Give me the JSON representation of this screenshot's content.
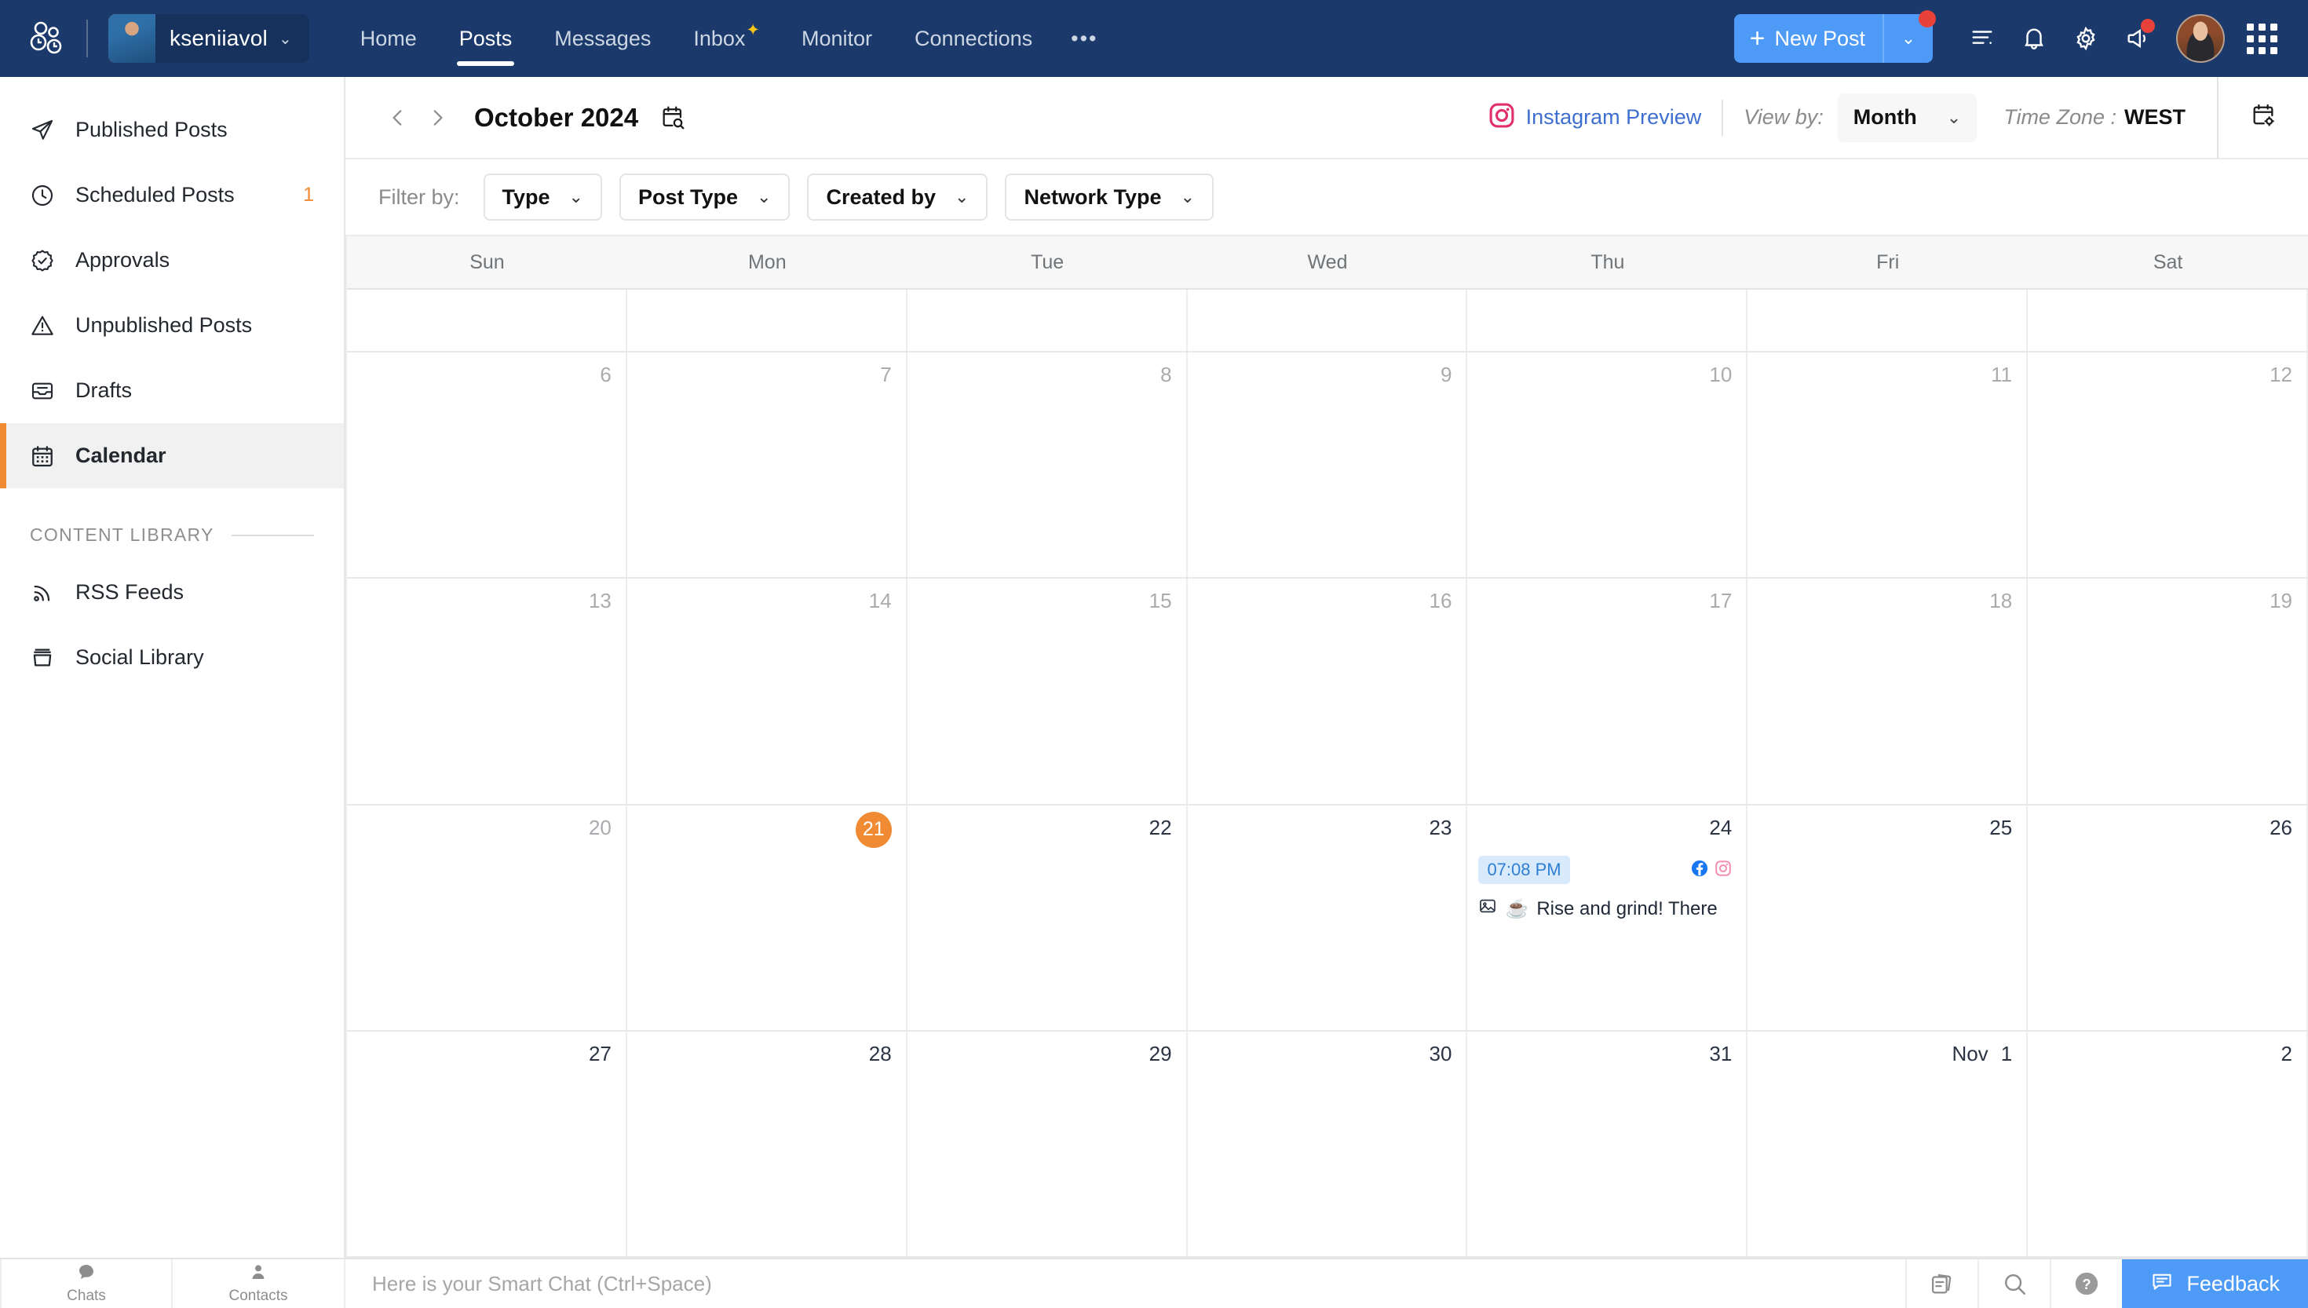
{
  "topnav": {
    "logo_icon": "zoho-social-logo-icon",
    "account": {
      "name": "kseniiavol",
      "avatar": "user-avatar",
      "caret": "⌄"
    },
    "tabs": [
      {
        "label": "Home",
        "active": false
      },
      {
        "label": "Posts",
        "active": true
      },
      {
        "label": "Messages",
        "active": false
      },
      {
        "label": "Inbox",
        "active": false,
        "sparkle": "✦"
      },
      {
        "label": "Monitor",
        "active": false
      },
      {
        "label": "Connections",
        "active": false
      }
    ],
    "more_label": "•••",
    "new_post": {
      "label": "New Post",
      "plus": "+",
      "caret": "⌄",
      "has_badge": true
    },
    "icons": [
      {
        "name": "activity-list-icon",
        "badge": false
      },
      {
        "name": "notifications-bell-icon",
        "badge": false
      },
      {
        "name": "settings-gear-icon",
        "badge": false
      },
      {
        "name": "announcement-megaphone-icon",
        "badge": true
      }
    ],
    "profile_avatar": "profile-avatar",
    "apps_grid_icon": "apps-grid-icon",
    "accent_blue": "#4e9af7",
    "brand_navy": "#1b3a6b",
    "badge_red": "#e8413a"
  },
  "sidebar": {
    "items": [
      {
        "label": "Published Posts",
        "icon": "paper-plane-icon",
        "badge": "",
        "active": false
      },
      {
        "label": "Scheduled Posts",
        "icon": "clock-icon",
        "badge": "1",
        "active": false
      },
      {
        "label": "Approvals",
        "icon": "check-seal-icon",
        "badge": "",
        "active": false
      },
      {
        "label": "Unpublished Posts",
        "icon": "warning-triangle-icon",
        "badge": "",
        "active": false
      },
      {
        "label": "Drafts",
        "icon": "drafts-tray-icon",
        "badge": "",
        "active": false
      },
      {
        "label": "Calendar",
        "icon": "calendar-icon",
        "badge": "",
        "active": true
      }
    ],
    "section_title": "CONTENT LIBRARY",
    "library_items": [
      {
        "label": "RSS Feeds",
        "icon": "rss-icon"
      },
      {
        "label": "Social Library",
        "icon": "archive-box-icon"
      }
    ],
    "active_accent": "#f08b34"
  },
  "toolbar": {
    "prev_icon": "chevron-left-icon",
    "next_icon": "chevron-right-icon",
    "title": "October 2024",
    "date_search_icon": "calendar-search-icon",
    "instagram_preview": {
      "label": "Instagram Preview",
      "icon": "instagram-icon",
      "color": "#3e6fd0"
    },
    "view_by_label": "View by:",
    "view_by_value": "Month",
    "view_by_caret": "⌄",
    "timezone_label": "Time Zone :",
    "timezone_value": "WEST",
    "calendar_settings_icon": "calendar-settings-icon"
  },
  "filters": {
    "label": "Filter by:",
    "chips": [
      {
        "label": "Type",
        "caret": "⌄"
      },
      {
        "label": "Post Type",
        "caret": "⌄"
      },
      {
        "label": "Created by",
        "caret": "⌄"
      },
      {
        "label": "Network Type",
        "caret": "⌄"
      }
    ]
  },
  "calendar": {
    "weekdays": [
      "Sun",
      "Mon",
      "Tue",
      "Wed",
      "Thu",
      "Fri",
      "Sat"
    ],
    "rows": [
      [
        {
          "num": "",
          "muted": true
        },
        {
          "num": "",
          "muted": true
        },
        {
          "num": "",
          "muted": true
        },
        {
          "num": "",
          "muted": true
        },
        {
          "num": "",
          "muted": true
        },
        {
          "num": "",
          "muted": true
        },
        {
          "num": "",
          "muted": true
        }
      ],
      [
        {
          "num": "6",
          "muted": true
        },
        {
          "num": "7",
          "muted": true
        },
        {
          "num": "8",
          "muted": true
        },
        {
          "num": "9",
          "muted": true
        },
        {
          "num": "10",
          "muted": true
        },
        {
          "num": "11",
          "muted": true
        },
        {
          "num": "12",
          "muted": true
        }
      ],
      [
        {
          "num": "13",
          "muted": true
        },
        {
          "num": "14",
          "muted": true
        },
        {
          "num": "15",
          "muted": true
        },
        {
          "num": "16",
          "muted": true
        },
        {
          "num": "17",
          "muted": true
        },
        {
          "num": "18",
          "muted": true
        },
        {
          "num": "19",
          "muted": true
        }
      ],
      [
        {
          "num": "20",
          "muted": true
        },
        {
          "num": "21",
          "muted": false,
          "today": true
        },
        {
          "num": "22",
          "muted": false
        },
        {
          "num": "23",
          "muted": false
        },
        {
          "num": "24",
          "muted": false,
          "event": {
            "time": "07:08 PM",
            "networks": [
              "facebook-icon",
              "instagram-icon"
            ],
            "media_icon": "image-icon",
            "emoji": "☕",
            "text": "Rise and grind! There"
          }
        },
        {
          "num": "25",
          "muted": false
        },
        {
          "num": "26",
          "muted": false
        }
      ],
      [
        {
          "num": "27",
          "muted": false
        },
        {
          "num": "28",
          "muted": false
        },
        {
          "num": "29",
          "muted": false
        },
        {
          "num": "30",
          "muted": false
        },
        {
          "num": "31",
          "muted": false
        },
        {
          "num": "1",
          "month": "Nov",
          "muted": false
        },
        {
          "num": "2",
          "muted": false
        }
      ]
    ],
    "today_color": "#f08b34"
  },
  "bottombar": {
    "tabs": [
      {
        "label": "Chats",
        "icon": "chat-bubble-icon"
      },
      {
        "label": "Contacts",
        "icon": "contact-person-icon"
      }
    ],
    "chat_placeholder": "Here is your Smart Chat (Ctrl+Space)",
    "icons": [
      {
        "name": "notes-stack-icon"
      },
      {
        "name": "search-icon"
      },
      {
        "name": "help-question-icon"
      }
    ],
    "feedback_label": "Feedback",
    "feedback_icon": "feedback-message-icon",
    "feedback_color": "#4e9af7"
  }
}
